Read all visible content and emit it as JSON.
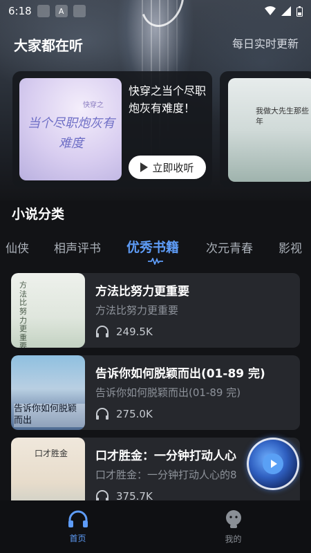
{
  "status_bar": {
    "time": "6:18"
  },
  "header": {
    "title": "大家都在听",
    "subtitle": "每日实时更新"
  },
  "banner": {
    "cards": [
      {
        "cover_text": "当个尽职炮灰有难度",
        "cover_tag": "快穿之",
        "title": "快穿之当个尽职炮灰有难度！",
        "button_label": "立即收听"
      },
      {
        "cover_text": "我做大先生那些年"
      }
    ]
  },
  "category": {
    "title": "小说分类",
    "tabs": [
      "仙侠",
      "相声评书",
      "优秀书籍",
      "次元青春",
      "影视"
    ],
    "active_tab": "优秀书籍"
  },
  "list": [
    {
      "cover_text": "方法比努力更重要",
      "title": "方法比努力更重要",
      "desc": "方法比努力更重要",
      "plays": "249.5K"
    },
    {
      "cover_text": "告诉你如何脱颖而出",
      "title": "告诉你如何脱颖而出(01-89 完)",
      "desc": "告诉你如何脱颖而出(01-89 完)",
      "plays": "275.0K"
    },
    {
      "cover_text": "口才胜金",
      "title": "口才胜金：一分钟打动人心",
      "desc": "口才胜金：一分钟打动人心的8",
      "plays": "375.7K"
    }
  ],
  "nav": {
    "home": "首页",
    "mine": "我的"
  },
  "colors": {
    "accent": "#5e9cf7",
    "background": "#121316",
    "card": "#26282d"
  }
}
